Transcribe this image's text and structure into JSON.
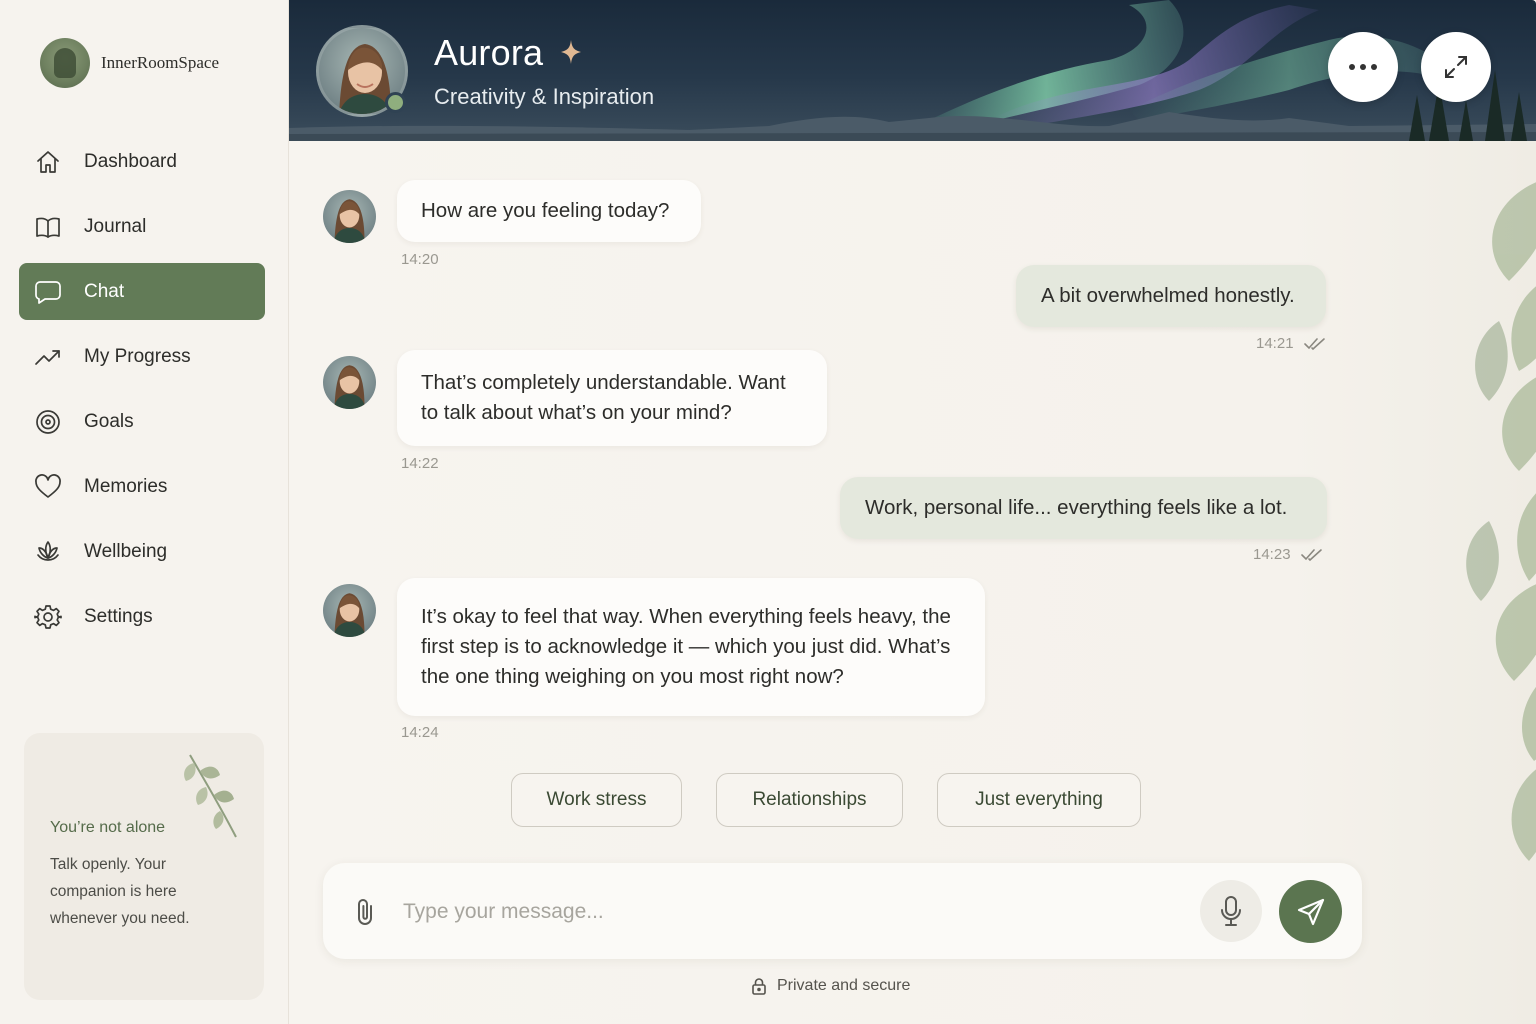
{
  "brand": {
    "name": "InnerRoomSpace"
  },
  "nav": {
    "items": [
      {
        "label": "Dashboard",
        "icon": "home-icon"
      },
      {
        "label": "Journal",
        "icon": "book-icon"
      },
      {
        "label": "Chat",
        "icon": "chat-icon",
        "active": true
      },
      {
        "label": "My Progress",
        "icon": "trend-icon"
      },
      {
        "label": "Goals",
        "icon": "target-icon"
      },
      {
        "label": "Memories",
        "icon": "heart-icon"
      },
      {
        "label": "Wellbeing",
        "icon": "lotus-icon"
      },
      {
        "label": "Settings",
        "icon": "gear-icon"
      }
    ]
  },
  "support": {
    "title": "You’re not alone",
    "text": "Talk openly. Your companion is here whenever you need."
  },
  "header": {
    "name": "Aurora",
    "subtitle": "Creativity & Inspiration",
    "status": "online"
  },
  "messages": [
    {
      "from": "companion",
      "text": "How are you feeling today?",
      "time": "14:20"
    },
    {
      "from": "user",
      "text": "A bit overwhelmed honestly.",
      "time": "14:21",
      "read": true
    },
    {
      "from": "companion",
      "text": "That’s completely understandable. Want to talk about what’s on your mind?",
      "time": "14:22"
    },
    {
      "from": "user",
      "text": "Work, personal life... everything feels like a lot.",
      "time": "14:23",
      "read": true
    },
    {
      "from": "companion",
      "text": "It’s okay to feel that way. When everything feels heavy, the first step is to acknowledge it — which you just did. What’s the one thing weighing on you most right now?",
      "time": "14:24"
    }
  ],
  "quick_replies": [
    "Work stress",
    "Relationships",
    "Just everything"
  ],
  "composer": {
    "placeholder": "Type your message...",
    "value": ""
  },
  "footer": {
    "secure_label": "Private and secure"
  },
  "colors": {
    "accent": "#627b57",
    "send": "#5b7550",
    "user_bubble": "#e4e8dd",
    "background": "#f6f3ee"
  }
}
